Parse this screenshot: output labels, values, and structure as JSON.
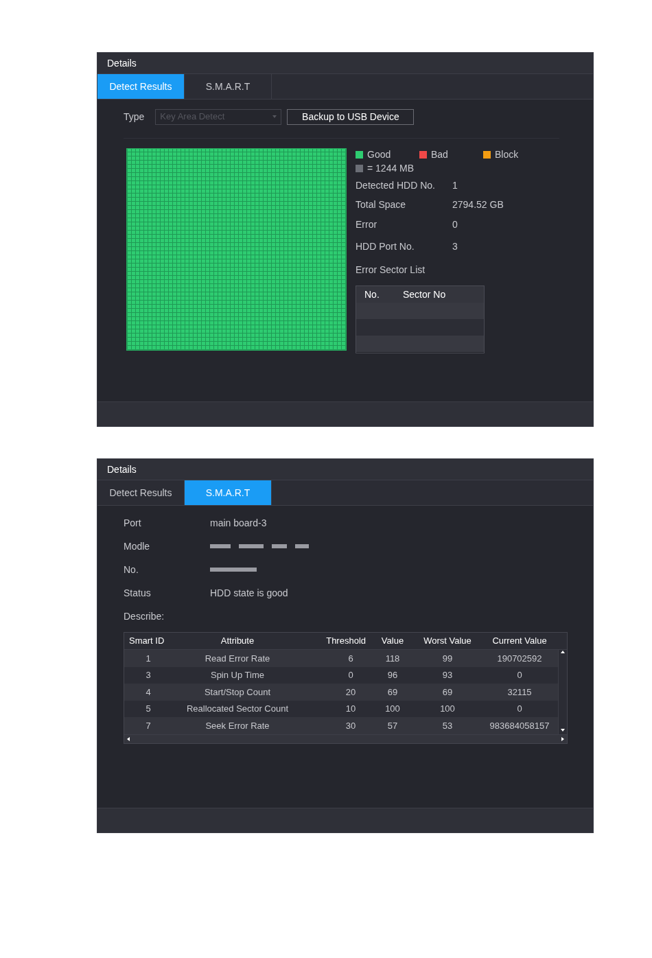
{
  "panels": [
    {
      "title": "Details",
      "tabs": [
        {
          "label": "Detect Results",
          "selected": true
        },
        {
          "label": "S.M.A.R.T",
          "selected": false
        }
      ],
      "kind": "detect",
      "type": {
        "label": "Type",
        "value": "Key Area Detect",
        "disabled": true
      },
      "backup_button": "Backup to USB Device",
      "legend": [
        {
          "label": "Good",
          "color": "#2ecc71"
        },
        {
          "label": "Bad",
          "color": "#f04848"
        },
        {
          "label": "Block",
          "color": "#f39c12"
        }
      ],
      "unit": {
        "label": "= 1244 MB",
        "color": "#6b6e76"
      },
      "info": [
        {
          "label": "Detected HDD No.",
          "value": "1"
        },
        {
          "label": "Total Space",
          "value": "2794.52 GB"
        },
        {
          "label": "Error",
          "value": "0"
        },
        {
          "label": "HDD Port No.",
          "value": "3"
        }
      ],
      "error_sector_list": {
        "title": "Error Sector List",
        "columns": [
          "No.",
          "Sector No"
        ]
      }
    },
    {
      "title": "Details",
      "tabs": [
        {
          "label": "Detect Results",
          "selected": false
        },
        {
          "label": "S.M.A.R.T",
          "selected": true
        }
      ],
      "kind": "smart",
      "fields": [
        {
          "label": "Port",
          "value": "main board-3",
          "kind": "text"
        },
        {
          "label": "Modle",
          "kind": "redacted"
        },
        {
          "label": "No.",
          "kind": "redacted"
        },
        {
          "label": "Status",
          "value": "HDD state is good",
          "kind": "text"
        },
        {
          "label": "Describe:",
          "kind": "label"
        }
      ],
      "table": {
        "columns": [
          "Smart ID",
          "Attribute",
          "Threshold",
          "Value",
          "Worst Value",
          "Current Value"
        ],
        "rows": [
          [
            "1",
            "Read Error Rate",
            "6",
            "118",
            "99",
            "190702592"
          ],
          [
            "3",
            "Spin Up Time",
            "0",
            "96",
            "93",
            "0"
          ],
          [
            "4",
            "Start/Stop Count",
            "20",
            "69",
            "69",
            "32115"
          ],
          [
            "5",
            "Reallocated Sector Count",
            "10",
            "100",
            "100",
            "0"
          ],
          [
            "7",
            "Seek Error Rate",
            "30",
            "57",
            "53",
            "983684058157"
          ]
        ]
      }
    }
  ]
}
